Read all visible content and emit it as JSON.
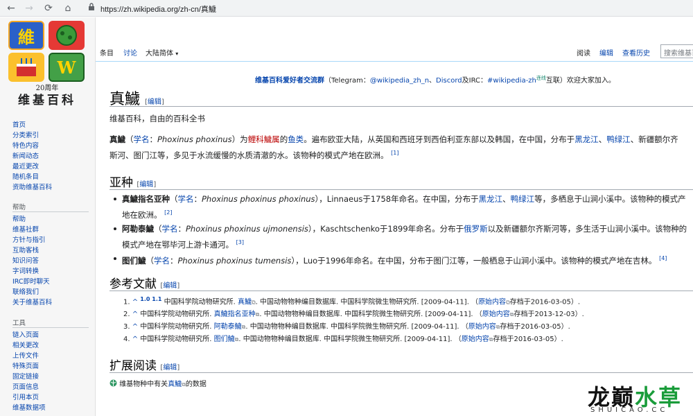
{
  "browser": {
    "url": "https://zh.wikipedia.org/zh-cn/真鱥"
  },
  "logo": {
    "tiles": [
      "維",
      "",
      "",
      "W"
    ],
    "year": "20周年",
    "name": "维基百科"
  },
  "sidebar": {
    "main": [
      "首页",
      "分类索引",
      "特色内容",
      "新闻动态",
      "最近更改",
      "随机条目",
      "资助维基百科"
    ],
    "help_heading": "帮助",
    "help": [
      "帮助",
      "维基社群",
      "方针与指引",
      "互助客栈",
      "知识问答",
      "字词转换",
      "IRC即时聊天",
      "联络我们",
      "关于维基百科"
    ],
    "tools_heading": "工具",
    "tools": [
      "链入页面",
      "相关更改",
      "上传文件",
      "特殊页面",
      "固定链接",
      "页面信息",
      "引用本页",
      "维基数据项"
    ]
  },
  "tabs": {
    "left": [
      "条目",
      "讨论"
    ],
    "variant": "大陆简体",
    "right": [
      "阅读",
      "编辑",
      "查看历史"
    ],
    "search_placeholder": "搜索维基百科"
  },
  "sitenotice": {
    "strong": "维基百科爱好者交流群",
    "t1": "（Telegram：",
    "l1": "@wikipedia_zh_n",
    "t2": "、",
    "l2": "Discord",
    "t3": "及IRC：",
    "l3": "#wikipedia-zh",
    "sup": "连线",
    "t4": "互联）欢迎大家加入。"
  },
  "article": {
    "title": "真鱥",
    "edit": "编辑",
    "tagline": "维基百科，自由的百科全书",
    "intro": {
      "bold": "真鱥",
      "p1": "（",
      "sci_link": "学名",
      "p2": "：",
      "sci": "Phoxinus phoxinus",
      "p3": "）为",
      "l1": "鲤科",
      "l2": "鱥属",
      "p4": "的",
      "l3": "鱼类",
      "p5": "。遍布欧亚大陆，从英国和西班牙到西伯利亚东部以及韩国，在中国，分布于",
      "l4": "黑龙江",
      "p6": "、",
      "l5": "鸭绿江",
      "p7": "、新疆额尔齐斯河、图门江等，多见于水流缓慢的水质清澈的水。该物种的模式产地在欧洲。",
      "ref": "[1]"
    },
    "subspecies_heading": "亚种",
    "subspecies": [
      {
        "name": "真鱥指名亚种",
        "sci": "Phoxinus phoxinus phoxinus",
        "mid": "），Linnaeus于1758年命名。在中国，分布于",
        "l1": "黑龙江",
        "m2": "、",
        "l2": "鸭绿江",
        "tail": "等，多栖息于山涧小溪中。该物种的模式产地在欧洲。",
        "ref": "[2]"
      },
      {
        "name": "阿勒泰鱥",
        "sci": "Phoxinus phoxinus ujmonensis",
        "mid": "），Kaschtschenko于1899年命名。分布于",
        "l1": "俄罗斯",
        "m2": "",
        "l2": "",
        "tail": "以及新疆额尔齐斯河等，多生活于山涧小溪中。该物种的模式产地在鄂毕河上游卡通河。",
        "ref": "[3]"
      },
      {
        "name": "图们鱥",
        "sci": "Phoxinus phoxinus tumensis",
        "mid": "），Luo于1996年命名。在中国，分布于图门江等，一般栖息于山涧小溪中。该物种的模式产地在吉林。",
        "l1": "",
        "m2": "",
        "l2": "",
        "tail": "",
        "ref": "[4]"
      }
    ],
    "sci_label": "学名",
    "refs_heading": "参考文献",
    "refs": [
      {
        "num": "1.",
        "back": "^ ",
        "backsup": "1.0 1.1",
        "pre": " 中国科学院动物研究所. ",
        "link": "真鱥",
        "post": ". 中国动物物种编目数据库. 中国科学院微生物研究所. [2009-04-11]. （",
        "arch": "原始内容",
        "end": "存档于2016-03-05）."
      },
      {
        "num": "2.",
        "back": "^ ",
        "backsup": "",
        "pre": "中国科学院动物研究所. ",
        "link": "真鱥指名亚种",
        "post": ". 中国动物物种编目数据库. 中国科学院微生物研究所. [2009-04-11]. （",
        "arch": "原始内容",
        "end": "存档于2013-12-03）."
      },
      {
        "num": "3.",
        "back": "^ ",
        "backsup": "",
        "pre": "中国科学院动物研究所. ",
        "link": "阿勒泰鱥",
        "post": ". 中国动物物种编目数据库. 中国科学院微生物研究所. [2009-04-11]. （",
        "arch": "原始内容",
        "end": "存档于2016-03-05）."
      },
      {
        "num": "4.",
        "back": "^ ",
        "backsup": "",
        "pre": "中国科学院动物研究所. ",
        "link": "图们鱥",
        "post": ". 中国动物物种编目数据库. 中国科学院微生物研究所. [2009-04-11]. （",
        "arch": "原始内容",
        "end": "存档于2016-03-05）."
      }
    ],
    "further_heading": "扩展阅读",
    "further": {
      "pre": "维基物种中有关",
      "link": "真鱥",
      "post": "的数据"
    }
  },
  "watermark": {
    "main_a": "龙巅",
    "main_b": "水草",
    "sub": "SHUICAO.CC"
  },
  "colors": {
    "link": "#0645ad",
    "redlink": "#ba0000",
    "wm_black": "#111111",
    "wm_green": "#1a9c3a"
  }
}
